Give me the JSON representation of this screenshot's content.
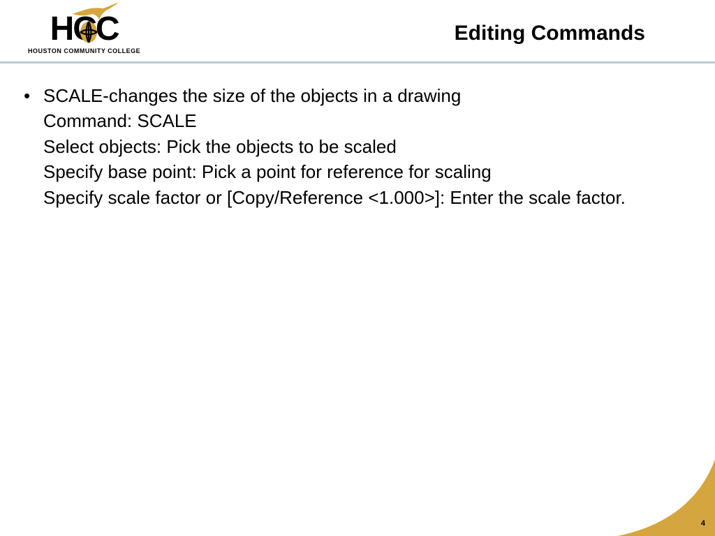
{
  "brand": {
    "gold": "#d5a63f"
  },
  "logo": {
    "main": "HCC",
    "sub": "HOUSTON COMMUNITY COLLEGE"
  },
  "title": "Editing Commands",
  "bullets": [
    {
      "lines": [
        "SCALE-changes the size of the objects in a drawing",
        "Command: SCALE",
        "Select objects: Pick the objects to be scaled",
        "Specify base point: Pick a point for reference for scaling",
        "Specify scale factor or [Copy/Reference <1.000>]: Enter the scale factor."
      ]
    }
  ],
  "page_number": "4"
}
